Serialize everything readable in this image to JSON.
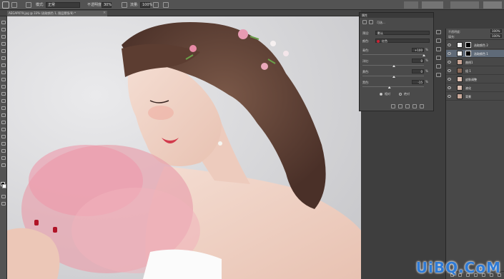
{
  "options_bar": {
    "mode_label": "模式:",
    "mode_value": "正常",
    "opacity_label": "不透明度:",
    "opacity_value": "30%",
    "flow_label": "流量:",
    "flow_value": "100%"
  },
  "document": {
    "tab_title": "AEGAP079.jpg @ 33% (选取颜色 1, 图层蒙版/8) *",
    "close_glyph": "×"
  },
  "properties": {
    "panel_title": "属性",
    "adjustment_title": "可选...",
    "preset_label": "预设:",
    "preset_value": "默认",
    "colors_label": "颜色:",
    "colors_value": "红色",
    "accent_color": "#cc2233",
    "sliders": [
      {
        "label": "青色:",
        "value": "+100",
        "pct": "%",
        "level": 1.0
      },
      {
        "label": "洋红:",
        "value": "0",
        "pct": "%",
        "level": 0.5
      },
      {
        "label": "黄色:",
        "value": "0",
        "pct": "%",
        "level": 0.5
      },
      {
        "label": "黑色:",
        "value": "-15",
        "pct": "%",
        "level": 0.425
      }
    ],
    "method_relative": "相对",
    "method_absolute": "绝对"
  },
  "layers": {
    "opacity_label": "不透明度:",
    "opacity_value": "100%",
    "fill_label": "填充:",
    "fill_value": "100%",
    "items": [
      {
        "name": "选取颜色 2",
        "has_mask": true,
        "active": false
      },
      {
        "name": "选取颜色 1",
        "has_mask": true,
        "active": true
      },
      {
        "name": "曲线1",
        "has_mask": false,
        "active": false
      },
      {
        "name": "组 1",
        "has_mask": false,
        "active": false
      },
      {
        "name": "皮肤调整",
        "has_mask": false,
        "active": false
      },
      {
        "name": "液化",
        "has_mask": false,
        "active": false
      },
      {
        "name": "背景",
        "has_mask": false,
        "active": false
      }
    ]
  },
  "watermark": "UiBQ.CoM"
}
